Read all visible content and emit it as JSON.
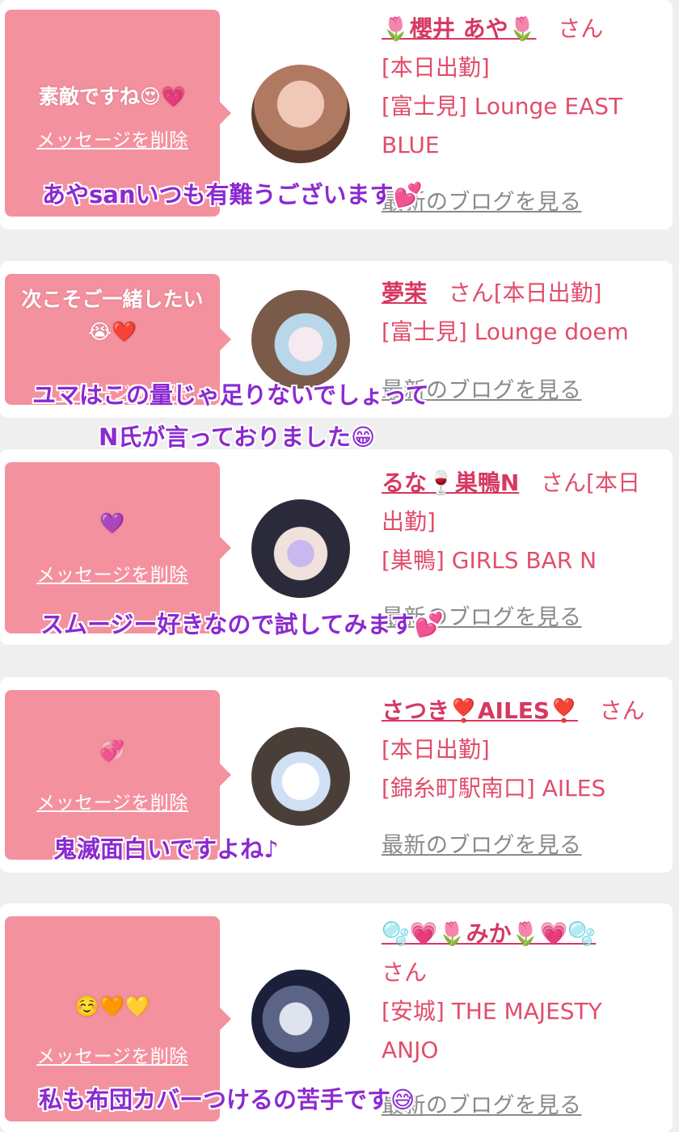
{
  "cards": [
    {
      "bubble_message": "素敵ですね😍💗",
      "delete_label": "メッセージを削除",
      "name": "🌷櫻井 あや🌷",
      "honorific": "さん",
      "status": "[本日出勤]",
      "store": "[富士見] Lounge EAST BLUE",
      "blog_label": "最新のブログを見る",
      "overlay": "あやsanいつも有難うございます💕"
    },
    {
      "bubble_message": "次こそご一緒したい😭❤️",
      "delete_label": "メッセージを削除",
      "name": "夢茉",
      "honorific": "さん",
      "status": "[本日出勤]",
      "store": "[富士見] Lounge doem",
      "blog_label": "最新のブログを見る",
      "overlay_line1": "ユマはこの量じゃ足りないでしょって",
      "overlay_line2": "N氏が言っておりました😁"
    },
    {
      "bubble_message": "💜",
      "delete_label": "メッセージを削除",
      "name": "るな🍷巣鴨N",
      "honorific": "さん",
      "status": "[本日出勤]",
      "store": "[巣鴨] GIRLS BAR N",
      "blog_label": "最新のブログを見る",
      "overlay": "スムージー好きなので試してみます💕"
    },
    {
      "bubble_message": "💞",
      "delete_label": "メッセージを削除",
      "name": "さつき❣️AILES❣️",
      "honorific": "さん",
      "status": "[本日出勤]",
      "store": "[錦糸町駅南口] AILES",
      "blog_label": "最新のブログを見る",
      "overlay": "鬼滅面白いですよね♪"
    },
    {
      "bubble_message": "☺️🧡💛",
      "delete_label": "メッセージを削除",
      "name": "🫧💗🌷みか🌷💗🫧",
      "honorific": "さん",
      "store": "[安城] THE MAJESTY ANJO",
      "blog_label": "最新のブログを見る",
      "overlay": "私も布団カバーつけるの苦手です😅"
    }
  ],
  "colors": {
    "bubble": "#f4919f",
    "name": "#d63861",
    "info_text": "#e14d6b",
    "overlay_text": "#8b2ad0",
    "blog_link": "#8a8a8a"
  }
}
